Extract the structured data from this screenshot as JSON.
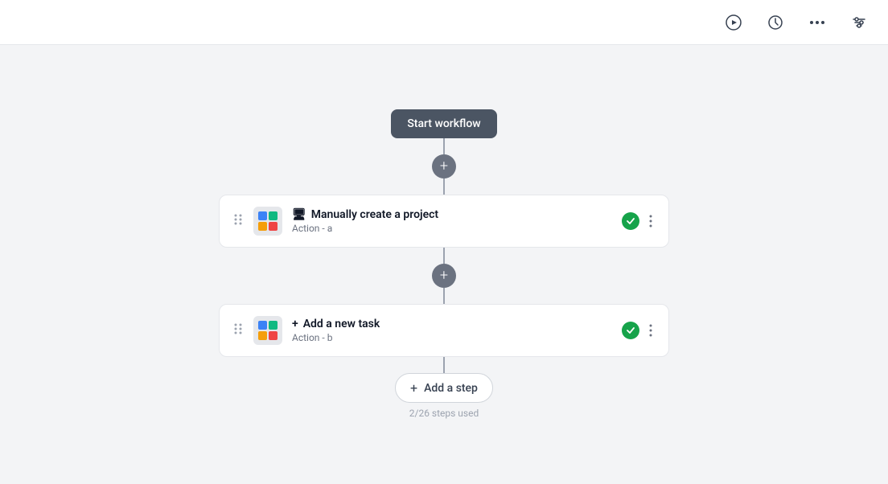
{
  "toolbar": {
    "play_icon": "▶",
    "history_icon": "🕐",
    "more_icon": "•••",
    "filter_icon": "⚙"
  },
  "canvas": {
    "start_node_label": "Start workflow",
    "steps": [
      {
        "id": "step-a",
        "title": "Manually create a project",
        "subtitle": "Action - a",
        "icon_prefix": "🖥",
        "status": "success"
      },
      {
        "id": "step-b",
        "title": "Add a new task",
        "subtitle": "Action - b",
        "icon_prefix": "+",
        "status": "success"
      }
    ],
    "add_step_label": "Add a step",
    "steps_used_label": "2/26 steps used"
  }
}
